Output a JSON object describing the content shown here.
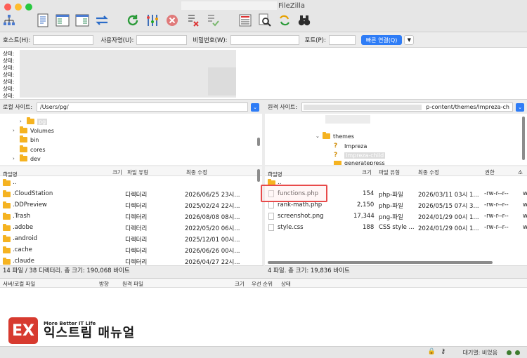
{
  "window": {
    "title": "FileZilla"
  },
  "quickconnect": {
    "host_label": "호스트(H):",
    "user_label": "사용자명(U):",
    "pass_label": "비밀번호(W):",
    "port_label": "포트(P):",
    "connect_label": "빠른 연결(Q)",
    "host_value": "",
    "user_value": "",
    "pass_value": "",
    "port_value": ""
  },
  "status_log": {
    "lines": [
      "상태:",
      "상태:",
      "상태:",
      "상태:",
      "상태:",
      "상태:",
      "상태:"
    ]
  },
  "local": {
    "site_label": "로컬 사이트:",
    "path": "/Users/pg/",
    "tree": [
      {
        "name": "pg",
        "selected": true
      },
      {
        "name": "Volumes"
      },
      {
        "name": "bin"
      },
      {
        "name": "cores"
      },
      {
        "name": "dev"
      }
    ],
    "headers": {
      "name": "파일명",
      "size": "크기",
      "type": "파일 유형",
      "modified": "최종 수정"
    },
    "files": [
      {
        "name": "..",
        "size": "",
        "type": "",
        "modified": ""
      },
      {
        "name": ".CloudStation",
        "size": "",
        "type": "디렉터리",
        "modified": "2026/06/25 23시..."
      },
      {
        "name": ".DDPreview",
        "size": "",
        "type": "디렉터리",
        "modified": "2025/02/24 22시..."
      },
      {
        "name": ".Trash",
        "size": "",
        "type": "디렉터리",
        "modified": "2026/08/08 08시..."
      },
      {
        "name": ".adobe",
        "size": "",
        "type": "디렉터리",
        "modified": "2022/05/20 06시..."
      },
      {
        "name": ".android",
        "size": "",
        "type": "디렉터리",
        "modified": "2025/12/01 00시..."
      },
      {
        "name": ".cache",
        "size": "",
        "type": "디렉터리",
        "modified": "2026/06/26 00시..."
      },
      {
        "name": ".claude",
        "size": "",
        "type": "디렉터리",
        "modified": "2026/04/27 22시..."
      }
    ],
    "summary": "14 파일 / 38 디렉터리. 총 크기: 190,068 바이트"
  },
  "remote": {
    "site_label": "원격 사이트:",
    "path": "p-content/themes/Impreza-ch",
    "tree": [
      {
        "name": "themes"
      },
      {
        "name": "Impreza",
        "unknown": true
      },
      {
        "name": "Impreza-child",
        "unknown": true,
        "selected": true
      },
      {
        "name": "generatepress"
      }
    ],
    "headers": {
      "name": "파일명",
      "size": "크기",
      "type": "파일 유형",
      "modified": "최종 수정",
      "perm": "권한",
      "owner": "소"
    },
    "files": [
      {
        "name": "..",
        "size": "",
        "type": "",
        "modified": "",
        "perm": "",
        "owner": ""
      },
      {
        "name": "functions.php",
        "size": "154",
        "type": "php-파일",
        "modified": "2026/03/11 03시 1...",
        "perm": "-rw-r--r--",
        "owner": "w"
      },
      {
        "name": "rank-math.php",
        "size": "2,150",
        "type": "php-파일",
        "modified": "2026/05/15 07시 3...",
        "perm": "-rw-r--r--",
        "owner": "w"
      },
      {
        "name": "screenshot.png",
        "size": "17,344",
        "type": "png-파일",
        "modified": "2024/01/29 00시 1...",
        "perm": "-rw-r--r--",
        "owner": "w"
      },
      {
        "name": "style.css",
        "size": "188",
        "type": "CSS style ...",
        "modified": "2024/01/29 00시 1...",
        "perm": "-rw-r--r--",
        "owner": "w"
      }
    ],
    "summary": "4 파일. 총 크기: 19,836 바이트"
  },
  "queue": {
    "headers": {
      "file": "서버/로컬 파일",
      "dir": "방향",
      "remote": "원격 파일",
      "size": "크기",
      "priority": "우선 순위",
      "status": "상태"
    }
  },
  "statusbar": {
    "queue_text": "대기열: 비었음"
  },
  "watermark": {
    "tagline": "More Better IT Life",
    "brand": "익스트림 매뉴얼"
  }
}
